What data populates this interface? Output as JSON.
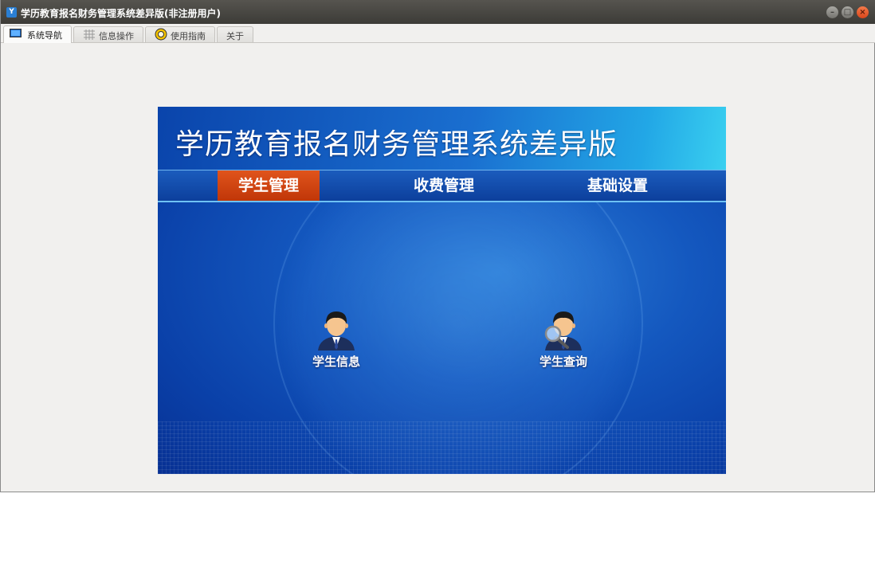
{
  "window": {
    "title": "学历教育报名财务管理系统差异版(非注册用户)",
    "app_icon": "app-logo-icon",
    "controls": [
      "minimize",
      "maximize",
      "close"
    ]
  },
  "tabs": [
    {
      "label": "系统导航",
      "icon": "monitor-icon",
      "active": true
    },
    {
      "label": "信息操作",
      "icon": "grid-icon",
      "active": false
    },
    {
      "label": "使用指南",
      "icon": "lifebuoy-icon",
      "active": false
    },
    {
      "label": "关于",
      "icon": "",
      "active": false
    }
  ],
  "banner": {
    "title": "学历教育报名财务管理系统差异版",
    "nav": [
      {
        "label": "学生管理",
        "active": true
      },
      {
        "label": "收费管理",
        "active": false
      },
      {
        "label": "基础设置",
        "active": false
      }
    ],
    "items": [
      {
        "label": "学生信息",
        "icon": "student-person-icon"
      },
      {
        "label": "学生查询",
        "icon": "student-search-icon"
      }
    ]
  },
  "colors": {
    "nav_active": "#d0440f",
    "banner_blue": "#1458bf"
  }
}
